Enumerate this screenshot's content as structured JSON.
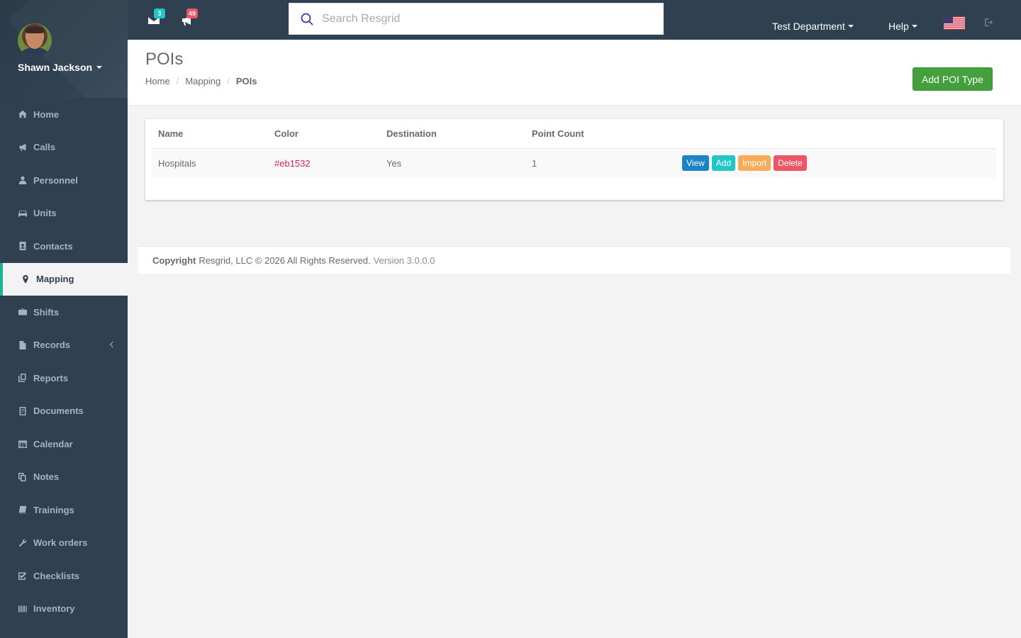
{
  "user": {
    "name": "Shawn Jackson"
  },
  "sidebar": {
    "items": [
      {
        "label": "Home",
        "icon": "home-icon"
      },
      {
        "label": "Calls",
        "icon": "bullhorn-icon"
      },
      {
        "label": "Personnel",
        "icon": "user-icon"
      },
      {
        "label": "Units",
        "icon": "truck-icon"
      },
      {
        "label": "Contacts",
        "icon": "address-book-icon"
      },
      {
        "label": "Mapping",
        "icon": "map-marker-icon",
        "active": true
      },
      {
        "label": "Shifts",
        "icon": "briefcase-icon"
      },
      {
        "label": "Records",
        "icon": "file-icon"
      },
      {
        "label": "Reports",
        "icon": "reports-icon"
      },
      {
        "label": "Documents",
        "icon": "document-icon"
      },
      {
        "label": "Calendar",
        "icon": "calendar-icon"
      },
      {
        "label": "Notes",
        "icon": "notes-icon"
      },
      {
        "label": "Trainings",
        "icon": "book-icon"
      },
      {
        "label": "Work orders",
        "icon": "wrench-icon"
      },
      {
        "label": "Checklists",
        "icon": "checklist-icon"
      },
      {
        "label": "Inventory",
        "icon": "barcode-icon"
      }
    ]
  },
  "topbar": {
    "messages_count": "3",
    "alerts_count": "49",
    "search_placeholder": "Search Resgrid",
    "department": "Test Department",
    "help": "Help"
  },
  "page": {
    "title": "POIs",
    "breadcrumb": {
      "home": "Home",
      "mapping": "Mapping",
      "current": "POIs"
    },
    "add_button": "Add POI Type"
  },
  "table": {
    "headers": {
      "name": "Name",
      "color": "Color",
      "destination": "Destination",
      "point_count": "Point Count"
    },
    "rows": [
      {
        "name": "Hospitals",
        "color": "#eb1532",
        "destination": "Yes",
        "point_count": "1"
      }
    ],
    "actions": {
      "view": "View",
      "add": "Add",
      "import": "Import",
      "delete": "Delete"
    }
  },
  "footer": {
    "copyright_label": "Copyright",
    "copyright_text": "Resgrid, LLC © 2026 All Rights Reserved.",
    "version": "Version 3.0.0.0"
  },
  "colors": {
    "sidebar_bg": "#2f4050",
    "primary_green": "#43a03d",
    "view": "#1c84c6",
    "add": "#23c6c8",
    "import": "#f8ac59",
    "delete": "#ed5565"
  }
}
